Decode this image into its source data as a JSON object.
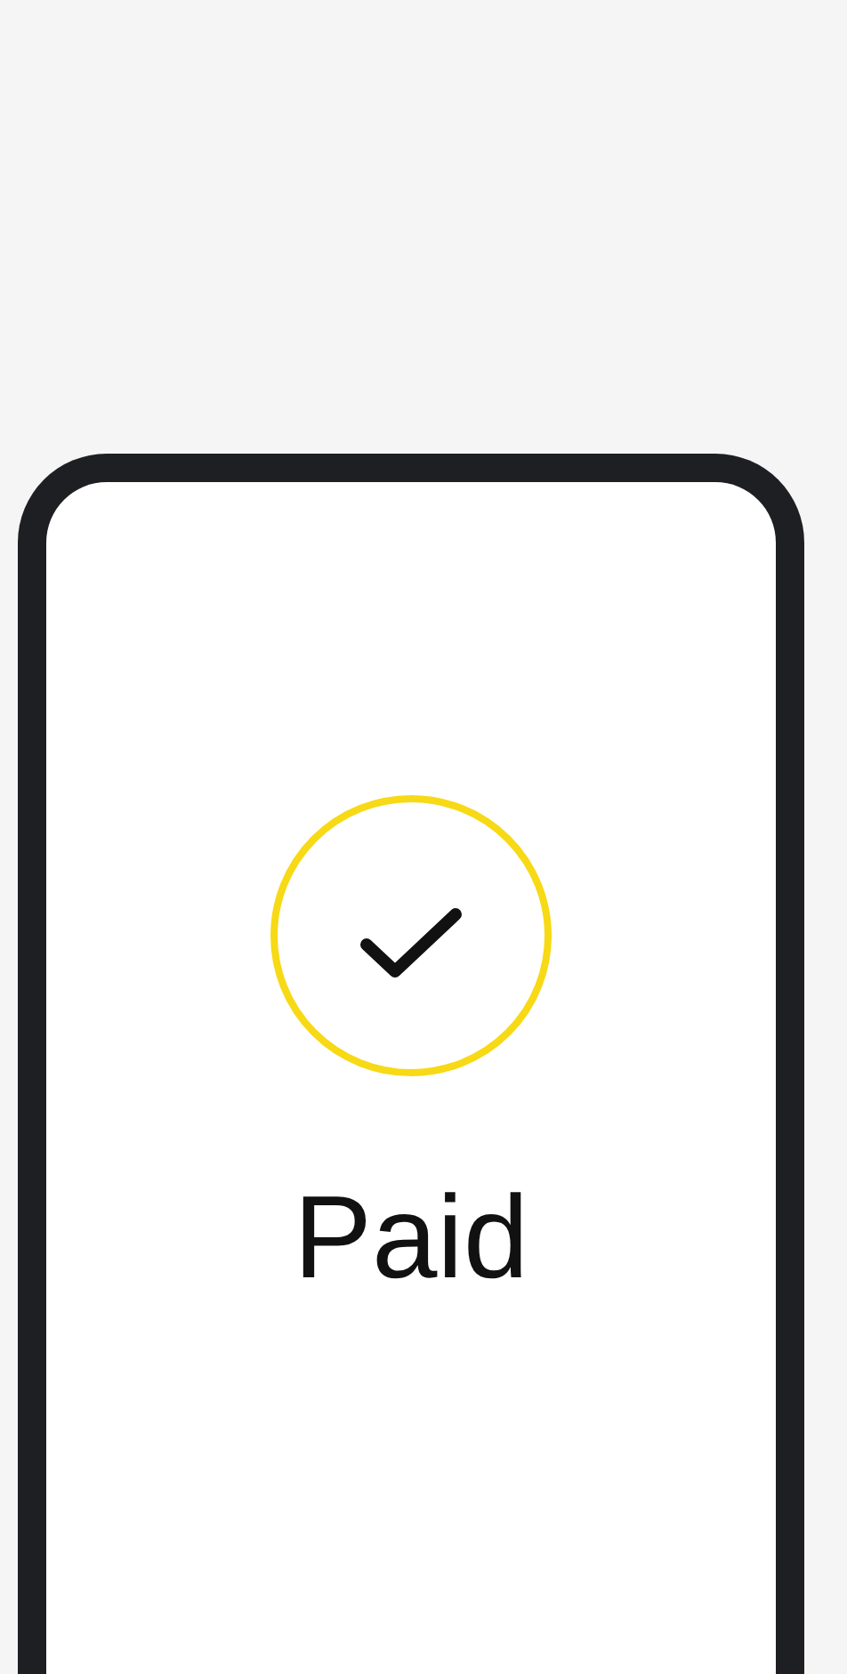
{
  "status": {
    "label": "Paid"
  }
}
